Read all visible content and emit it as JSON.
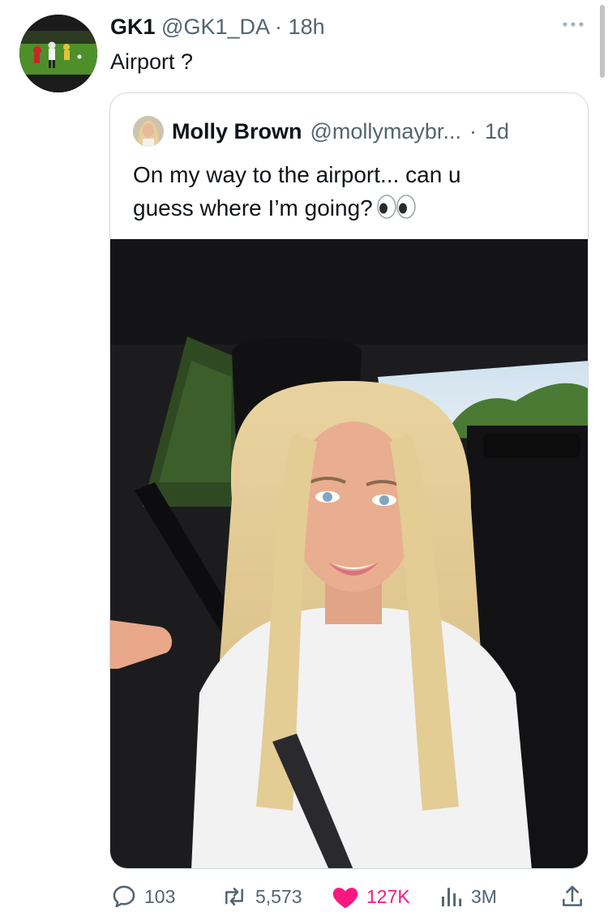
{
  "tweet": {
    "author": {
      "display_name": "GK1",
      "handle": "@GK1_DA",
      "separator": "·",
      "time": "18h",
      "avatar_icon": "football-match-avatar"
    },
    "text": "Airport ?",
    "more_icon": "ellipsis-icon"
  },
  "quoted_tweet": {
    "author": {
      "display_name": "Molly Brown",
      "handle": "@mollymaybr...",
      "separator": "·",
      "time": "1d",
      "avatar_icon": "profile-photo-avatar"
    },
    "text_line1": "On my way to the airport... can u",
    "text_line2": "guess where I’m going?",
    "emoji": "eyes-emoji",
    "media": "selfie-in-car-photo"
  },
  "actions": {
    "reply": {
      "icon": "reply-icon",
      "count": "103"
    },
    "retweet": {
      "icon": "retweet-icon",
      "count": "5,573"
    },
    "like": {
      "icon": "heart-icon",
      "count": "127K",
      "liked": true,
      "color": "#f91880"
    },
    "views": {
      "icon": "views-icon",
      "count": "3M"
    },
    "share": {
      "icon": "share-icon"
    }
  },
  "colors": {
    "text_primary": "#0f1419",
    "text_muted": "#536471",
    "border": "#cfd9de",
    "like": "#f91880"
  }
}
